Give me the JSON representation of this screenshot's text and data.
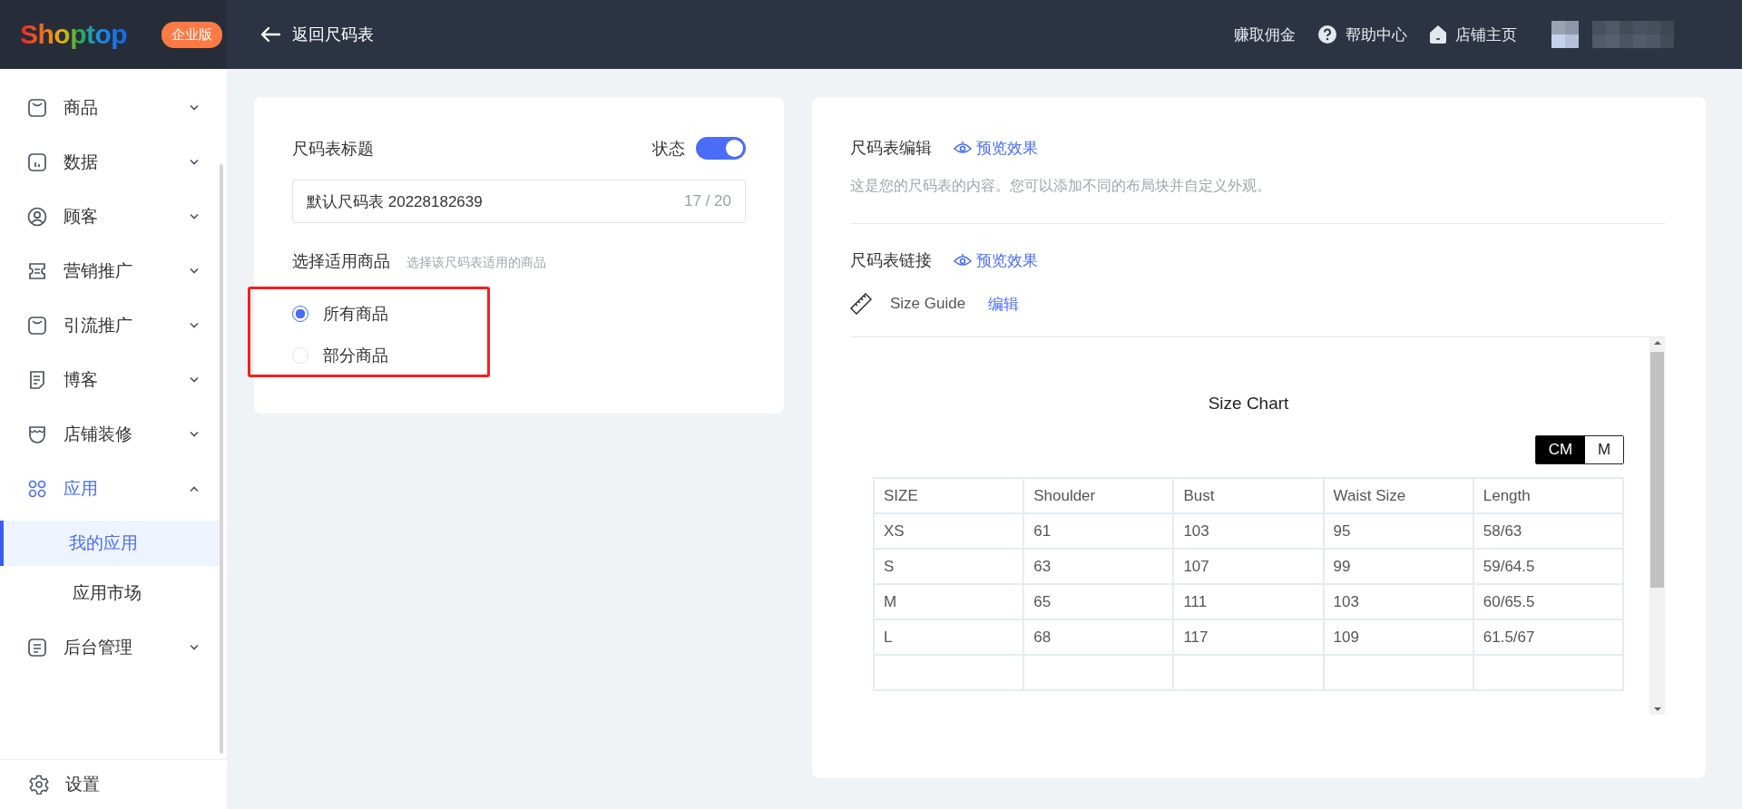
{
  "header": {
    "logo": "Shoptop",
    "edition_badge": "企业版",
    "back_link": "返回尺码表",
    "links": [
      {
        "label": "赚取佣金",
        "kind": "text"
      },
      {
        "label": "帮助中心",
        "kind": "help"
      },
      {
        "label": "店铺主页",
        "kind": "store"
      }
    ]
  },
  "sidebar": {
    "items": [
      {
        "label": "商品",
        "expanded": false
      },
      {
        "label": "数据",
        "expanded": false
      },
      {
        "label": "顾客",
        "expanded": false
      },
      {
        "label": "营销推广",
        "expanded": false
      },
      {
        "label": "引流推广",
        "expanded": false
      },
      {
        "label": "博客",
        "expanded": false
      },
      {
        "label": "店铺装修",
        "expanded": false
      },
      {
        "label": "应用",
        "expanded": true,
        "children": [
          {
            "label": "我的应用",
            "selected": true
          },
          {
            "label": "应用市场",
            "selected": false
          }
        ]
      },
      {
        "label": "后台管理",
        "expanded": false
      }
    ],
    "footer": "设置"
  },
  "title_card": {
    "title_label": "尺码表标题",
    "status_label": "状态",
    "status_on": true,
    "title_value": "默认尺码表 20228182639",
    "counter": "17 / 20",
    "products_label": "选择适用商品",
    "products_hint": "选择该尺码表适用的商品",
    "options": [
      {
        "label": "所有商品",
        "selected": true
      },
      {
        "label": "部分商品",
        "selected": false
      }
    ]
  },
  "editor_card": {
    "edit_title": "尺码表编辑",
    "edit_preview": "预览效果",
    "edit_description": "这是您的尺码表的内容。您可以添加不同的布局块并自定义外观。",
    "link_title": "尺码表链接",
    "link_preview": "预览效果",
    "link_name": "Size Guide",
    "link_edit": "编辑",
    "preview": {
      "title": "Size Chart",
      "units": [
        {
          "label": "CM",
          "selected": true
        },
        {
          "label": "M",
          "selected": false
        }
      ],
      "columns": [
        "SIZE",
        "Shoulder",
        "Bust",
        "Waist Size",
        "Length"
      ],
      "rows": [
        [
          "XS",
          "61",
          "103",
          "95",
          "58/63"
        ],
        [
          "S",
          "63",
          "107",
          "99",
          "59/64.5"
        ],
        [
          "M",
          "65",
          "111",
          "103",
          "60/65.5"
        ],
        [
          "L",
          "68",
          "117",
          "109",
          "61.5/67"
        ]
      ]
    }
  }
}
